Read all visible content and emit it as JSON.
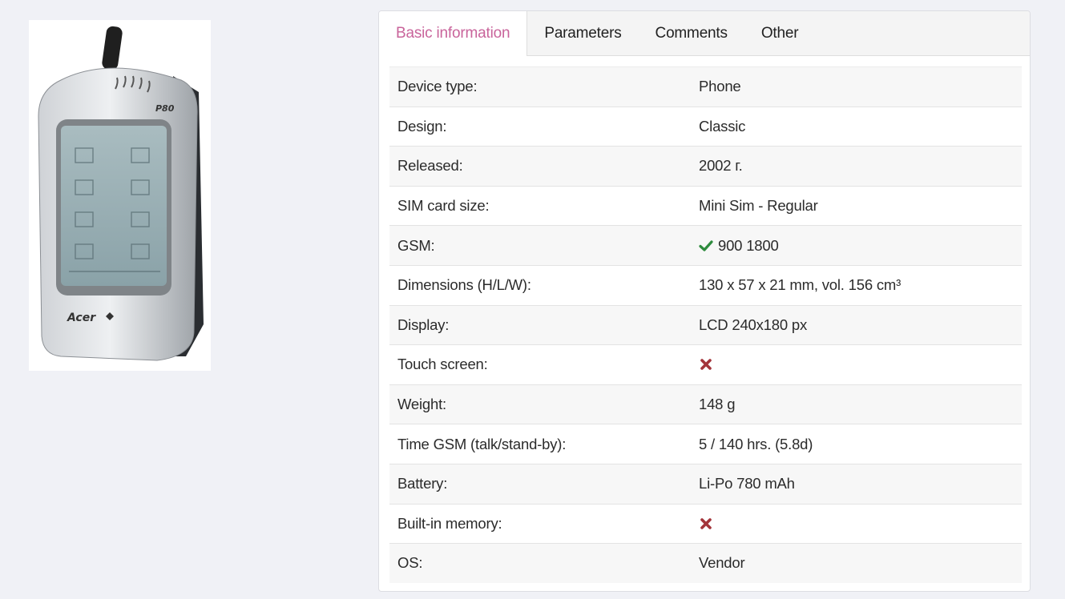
{
  "product_image": {
    "brand": "Acer",
    "model": "P80"
  },
  "tabs": [
    {
      "label": "Basic information",
      "active": true
    },
    {
      "label": "Parameters",
      "active": false
    },
    {
      "label": "Comments",
      "active": false
    },
    {
      "label": "Other",
      "active": false
    }
  ],
  "specs": [
    {
      "label": "Device type:",
      "value": "Phone",
      "icon": ""
    },
    {
      "label": "Design:",
      "value": "Classic",
      "icon": ""
    },
    {
      "label": "Released:",
      "value": "2002 г.",
      "icon": ""
    },
    {
      "label": "SIM card size:",
      "value": "Mini Sim - Regular",
      "icon": ""
    },
    {
      "label": "GSM:",
      "value": "900 1800",
      "icon": "check-icon"
    },
    {
      "label": "Dimensions (H/L/W):",
      "value": "130 x 57 x 21 mm, vol. 156 cm³",
      "icon": ""
    },
    {
      "label": "Display:",
      "value": "LCD 240x180 px",
      "icon": ""
    },
    {
      "label": "Touch screen:",
      "value": "",
      "icon": "cross-icon"
    },
    {
      "label": "Weight:",
      "value": "148 g",
      "icon": ""
    },
    {
      "label": "Time GSM (talk/stand-by):",
      "value": "5 / 140 hrs. (5.8d)",
      "icon": ""
    },
    {
      "label": "Battery:",
      "value": "Li-Po 780 mAh",
      "icon": ""
    },
    {
      "label": "Built-in memory:",
      "value": "",
      "icon": "cross-icon"
    },
    {
      "label": "OS:",
      "value": "Vendor",
      "icon": ""
    }
  ],
  "colors": {
    "active_tab_text": "#c9649b",
    "check_green": "#2e8b3e",
    "cross_red": "#a3343a",
    "page_background": "#f0f1f6"
  }
}
